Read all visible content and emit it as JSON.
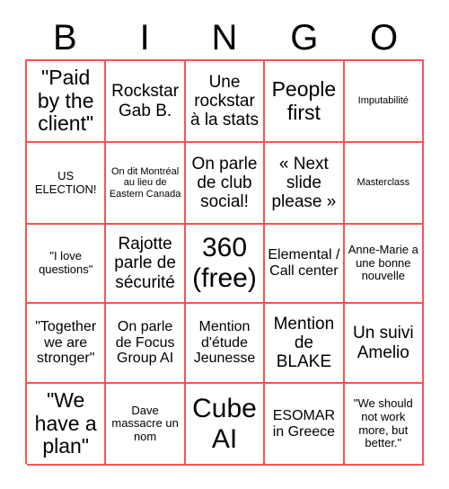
{
  "card": {
    "header_letters": [
      "B",
      "I",
      "N",
      "G",
      "O"
    ],
    "border_color": "#fc5353",
    "text_color": "#000000",
    "background_color": "#ffffff",
    "rows": 5,
    "columns": 5
  },
  "cells": [
    {
      "text": "\"Paid by the client\"",
      "size": "lg"
    },
    {
      "text": "Rockstar Gab B.",
      "size": "md"
    },
    {
      "text": "Une rockstar à la stats",
      "size": "md"
    },
    {
      "text": "People first",
      "size": "lg"
    },
    {
      "text": "Imputabilité",
      "size": "xxs"
    },
    {
      "text": "US ELECTION!",
      "size": "xs"
    },
    {
      "text": "On dit Montréal au lieu de Eastern Canada",
      "size": "xxs"
    },
    {
      "text": "On parle de club social!",
      "size": "md"
    },
    {
      "text": "« Next slide please »",
      "size": "md"
    },
    {
      "text": "Masterclass",
      "size": "xxs"
    },
    {
      "text": "\"I love questions\"",
      "size": "xs"
    },
    {
      "text": "Rajotte parle de sécurité",
      "size": "md"
    },
    {
      "text": "360 (free)",
      "size": "xl"
    },
    {
      "text": "Elemental / Call center",
      "size": "sm"
    },
    {
      "text": "Anne-Marie a une bonne nouvelle",
      "size": "xs"
    },
    {
      "text": "\"Together we are stronger\"",
      "size": "sm"
    },
    {
      "text": "On parle de Focus Group AI",
      "size": "sm"
    },
    {
      "text": "Mention d'étude Jeunesse",
      "size": "sm"
    },
    {
      "text": "Mention de BLAKE",
      "size": "md"
    },
    {
      "text": "Un suivi Amelio",
      "size": "md"
    },
    {
      "text": "\"We have a plan\"",
      "size": "lg"
    },
    {
      "text": "Dave massacre un nom",
      "size": "xs"
    },
    {
      "text": "Cube AI",
      "size": "xl"
    },
    {
      "text": "ESOMAR in Greece",
      "size": "sm"
    },
    {
      "text": "\"We should not work more, but better.\"",
      "size": "xs"
    }
  ]
}
